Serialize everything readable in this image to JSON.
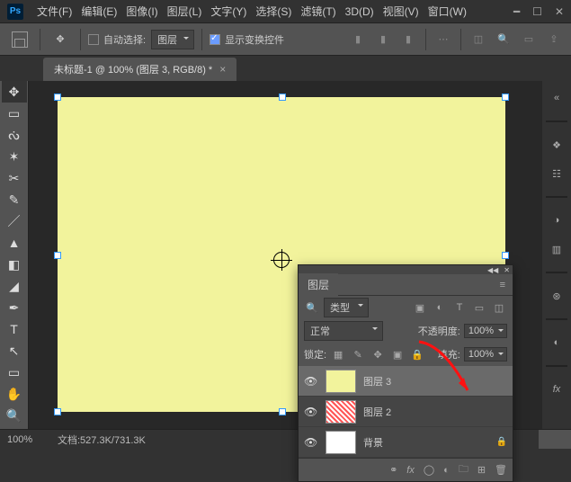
{
  "app": {
    "logo": "Ps"
  },
  "menu": [
    "文件(F)",
    "编辑(E)",
    "图像(I)",
    "图层(L)",
    "文字(Y)",
    "选择(S)",
    "滤镜(T)",
    "3D(D)",
    "视图(V)",
    "窗口(W)"
  ],
  "options": {
    "auto_select_label": "自动选择:",
    "auto_select_dd": "图层",
    "show_transform": "显示变换控件"
  },
  "doc_tab": "未标题-1 @ 100% (图层 3, RGB/8) *",
  "layers_panel": {
    "title": "图层",
    "kind_label": "类型",
    "blend_mode": "正常",
    "opacity_label": "不透明度:",
    "opacity_val": "100%",
    "lock_label": "锁定:",
    "fill_label": "填充:",
    "fill_val": "100%",
    "layers": [
      {
        "name": "图层 3"
      },
      {
        "name": "图层 2"
      },
      {
        "name": "背景"
      }
    ]
  },
  "status": {
    "zoom": "100%",
    "doc": "文档:527.3K/731.3K"
  }
}
